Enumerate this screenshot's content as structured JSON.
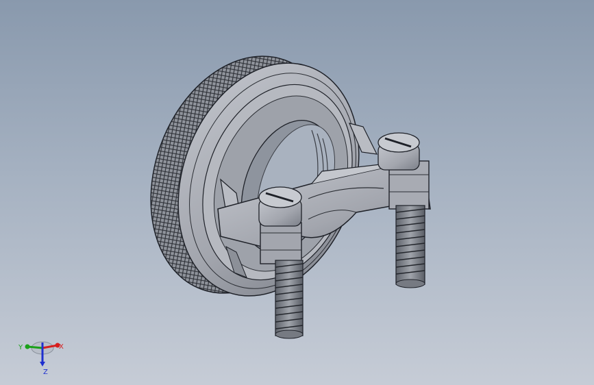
{
  "triad": {
    "x_label": "X",
    "y_label": "Y",
    "z_label": "Z",
    "x_color": "#d61f1f",
    "y_color": "#1aa11a",
    "z_color": "#1e2fcf"
  },
  "model": {
    "description_icon": "cad-part-knurled-nut-with-ground-clamp",
    "body_color": "#a9acb4",
    "shade_color": "#6e727b",
    "edge_color": "#1e2128"
  }
}
